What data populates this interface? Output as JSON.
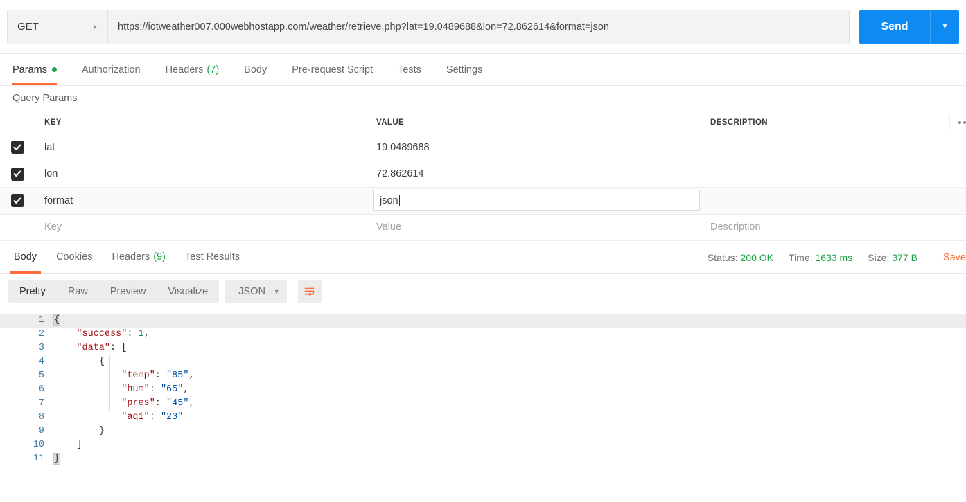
{
  "request": {
    "method": "GET",
    "method_caret": "caret-down-icon",
    "url": "https://iotweather007.000webhostapp.com/weather/retrieve.php?lat=19.0489688&lon=72.862614&format=json",
    "send_label": "Send",
    "send_caret": "caret-down-icon",
    "tabs": [
      {
        "label": "Params",
        "badge_dot": true,
        "active": true
      },
      {
        "label": "Authorization",
        "active": false
      },
      {
        "label": "Headers",
        "count": "(7)",
        "active": false
      },
      {
        "label": "Body",
        "active": false
      },
      {
        "label": "Pre-request Script",
        "active": false
      },
      {
        "label": "Tests",
        "active": false
      },
      {
        "label": "Settings",
        "active": false
      }
    ]
  },
  "query_params": {
    "title": "Query Params",
    "columns": [
      "KEY",
      "VALUE",
      "DESCRIPTION"
    ],
    "rows": [
      {
        "checked": true,
        "key": "lat",
        "value": "19.0489688",
        "description": "",
        "focused": false,
        "hover": false
      },
      {
        "checked": true,
        "key": "lon",
        "value": "72.862614",
        "description": "",
        "focused": false,
        "hover": false
      },
      {
        "checked": true,
        "key": "format",
        "value": "json",
        "description": "",
        "focused": true,
        "hover": true
      }
    ],
    "empty_row": {
      "key_placeholder": "Key",
      "value_placeholder": "Value",
      "description_placeholder": "Description"
    },
    "overflow_icon": "more-options-icon"
  },
  "response": {
    "tabs": [
      {
        "label": "Body",
        "active": true
      },
      {
        "label": "Cookies",
        "active": false
      },
      {
        "label": "Headers",
        "count": "(9)",
        "active": false
      },
      {
        "label": "Test Results",
        "active": false
      }
    ],
    "status_label": "Status:",
    "status_value": "200 OK",
    "time_label": "Time:",
    "time_value": "1633 ms",
    "size_label": "Size:",
    "size_value": "377 B",
    "save_label": "Save",
    "format_tabs": [
      {
        "label": "Pretty",
        "active": true
      },
      {
        "label": "Raw",
        "active": false
      },
      {
        "label": "Preview",
        "active": false
      },
      {
        "label": "Visualize",
        "active": false
      }
    ],
    "content_type": "JSON",
    "content_type_caret": "caret-down-icon",
    "wrap_icon": "word-wrap-icon",
    "body_lines": [
      {
        "n": "1",
        "indent": 0,
        "tokens": [
          {
            "t": "{",
            "c": "brkt"
          }
        ],
        "highlight": true
      },
      {
        "n": "2",
        "indent": 1,
        "tokens": [
          {
            "t": "\"success\"",
            "c": "k"
          },
          {
            "t": ": ",
            "c": "p"
          },
          {
            "t": "1",
            "c": "n"
          },
          {
            "t": ",",
            "c": "p"
          }
        ],
        "highlight": false
      },
      {
        "n": "3",
        "indent": 1,
        "tokens": [
          {
            "t": "\"data\"",
            "c": "k"
          },
          {
            "t": ": [",
            "c": "p"
          }
        ],
        "highlight": false
      },
      {
        "n": "4",
        "indent": 2,
        "tokens": [
          {
            "t": "{",
            "c": "p"
          }
        ],
        "highlight": false
      },
      {
        "n": "5",
        "indent": 3,
        "tokens": [
          {
            "t": "\"temp\"",
            "c": "k"
          },
          {
            "t": ": ",
            "c": "p"
          },
          {
            "t": "\"85\"",
            "c": "s"
          },
          {
            "t": ",",
            "c": "p"
          }
        ],
        "highlight": false
      },
      {
        "n": "6",
        "indent": 3,
        "tokens": [
          {
            "t": "\"hum\"",
            "c": "k"
          },
          {
            "t": ": ",
            "c": "p"
          },
          {
            "t": "\"65\"",
            "c": "s"
          },
          {
            "t": ",",
            "c": "p"
          }
        ],
        "highlight": false
      },
      {
        "n": "7",
        "indent": 3,
        "tokens": [
          {
            "t": "\"pres\"",
            "c": "k"
          },
          {
            "t": ": ",
            "c": "p"
          },
          {
            "t": "\"45\"",
            "c": "s"
          },
          {
            "t": ",",
            "c": "p"
          }
        ],
        "highlight": false
      },
      {
        "n": "8",
        "indent": 3,
        "tokens": [
          {
            "t": "\"aqi\"",
            "c": "k"
          },
          {
            "t": ": ",
            "c": "p"
          },
          {
            "t": "\"23\"",
            "c": "s"
          }
        ],
        "highlight": false
      },
      {
        "n": "9",
        "indent": 2,
        "tokens": [
          {
            "t": "}",
            "c": "p"
          }
        ],
        "highlight": false
      },
      {
        "n": "10",
        "indent": 1,
        "tokens": [
          {
            "t": "]",
            "c": "p"
          }
        ],
        "highlight": false
      },
      {
        "n": "11",
        "indent": 0,
        "tokens": [
          {
            "t": "}",
            "c": "brkt"
          }
        ],
        "highlight": false
      }
    ]
  },
  "colors": {
    "accent_orange": "#ff6c37",
    "send_blue": "#0d8bf2",
    "status_green": "#1ea34a",
    "json_key_red": "#a31515",
    "json_string_blue": "#0451a5",
    "json_number_green": "#098658",
    "line_number_blue": "#3e7ca6"
  }
}
